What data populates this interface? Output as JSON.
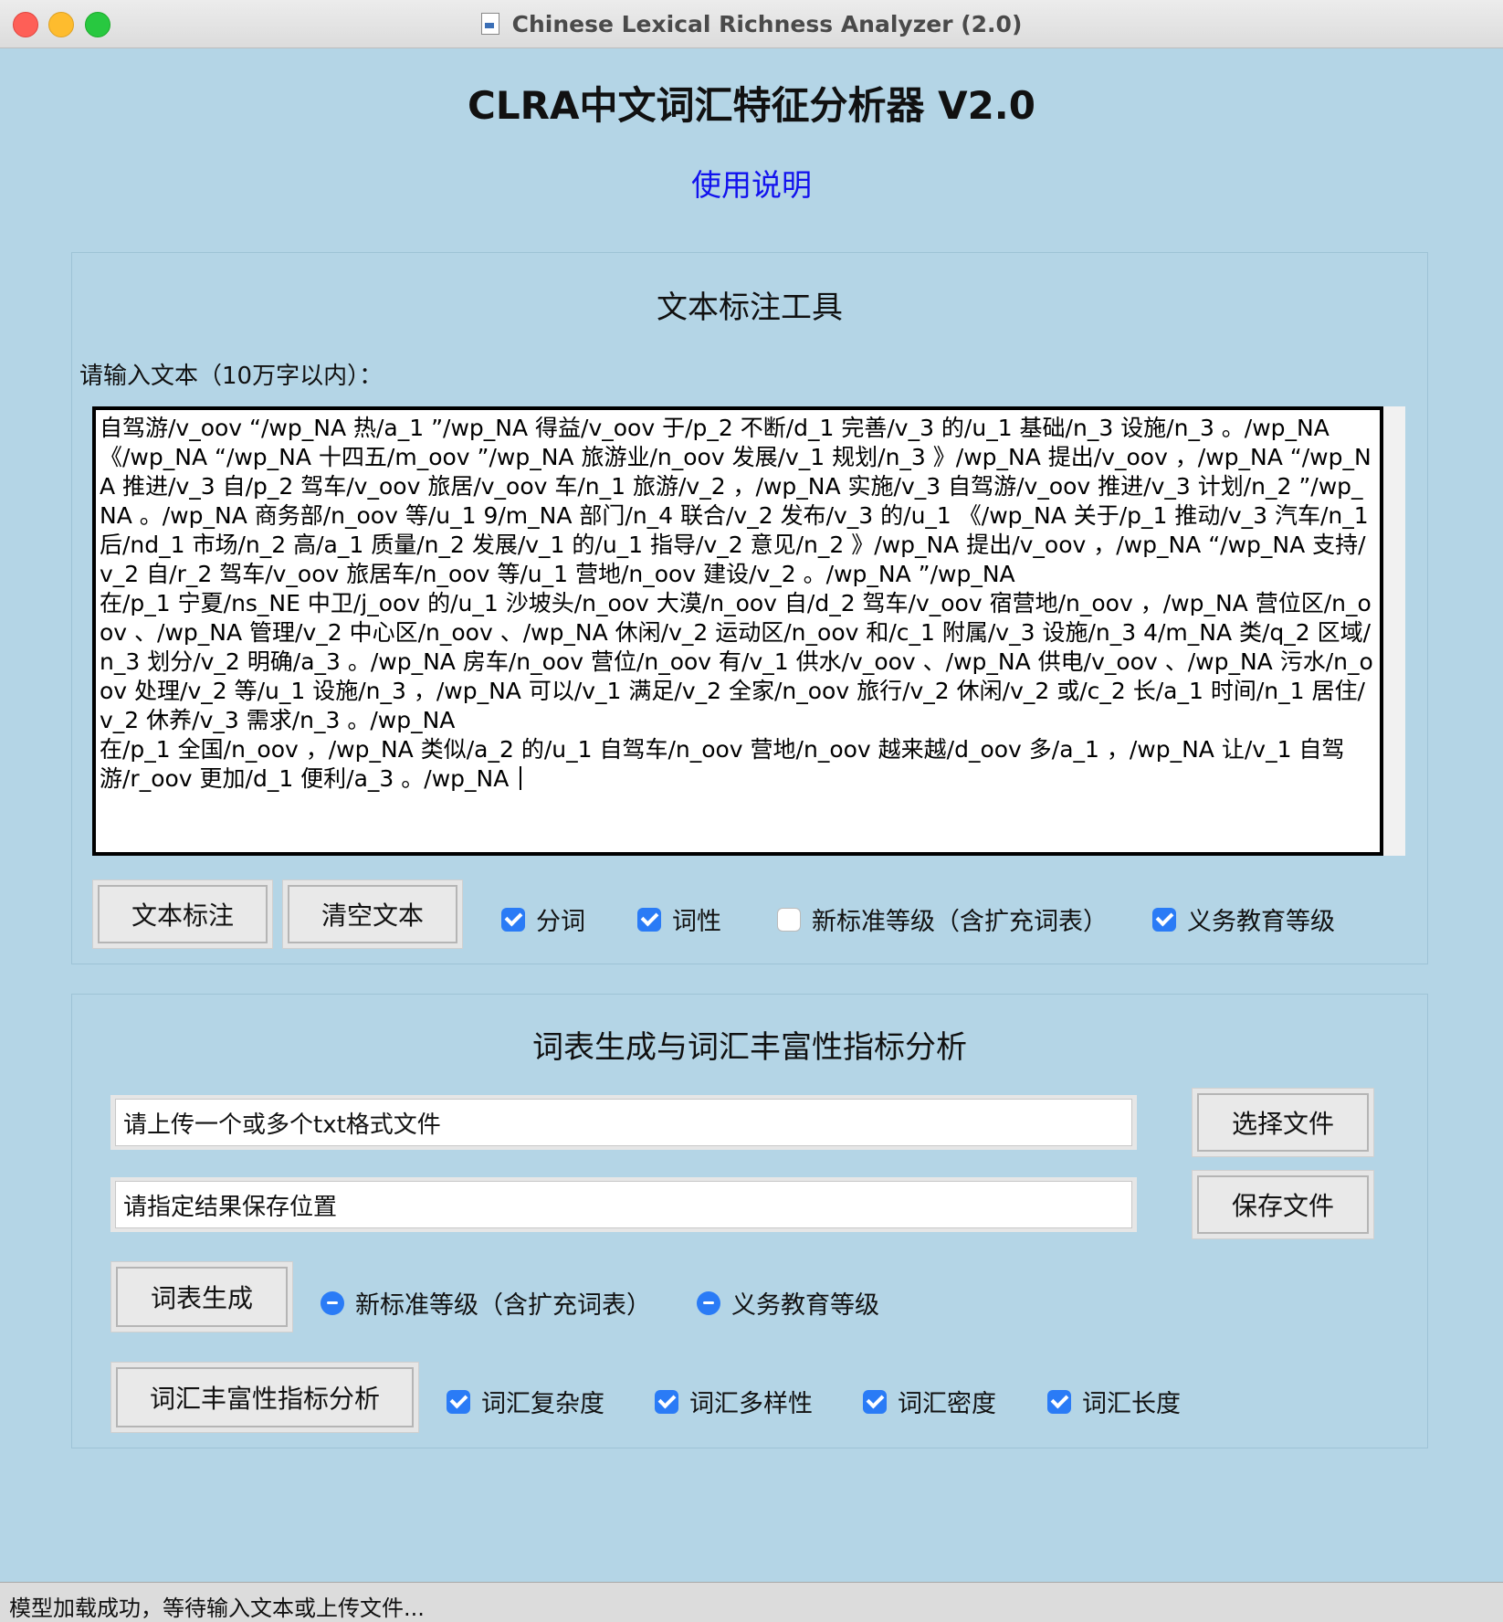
{
  "window": {
    "title": "Chinese Lexical Richness Analyzer (2.0)"
  },
  "app": {
    "heading": "CLRA中文词汇特征分析器 V2.0",
    "help_link": "使用说明"
  },
  "annotation_tool": {
    "title": "文本标注工具",
    "input_label": "请输入文本（10万字以内）：",
    "text": "自驾游/v_oov “/wp_NA 热/a_1 ”/wp_NA 得益/v_oov 于/p_2 不断/d_1 完善/v_3 的/u_1 基础/n_3 设施/n_3 。/wp_NA\n《/wp_NA “/wp_NA 十四五/m_oov ”/wp_NA 旅游业/n_oov 发展/v_1 规划/n_3 》/wp_NA 提出/v_oov ，/wp_NA “/wp_NA 推进/v_3 自/p_2 驾车/v_oov 旅居/v_oov 车/n_1 旅游/v_2 ，/wp_NA 实施/v_3 自驾游/v_oov 推进/v_3 计划/n_2 ”/wp_NA 。/wp_NA 商务部/n_oov 等/u_1 9/m_NA 部门/n_4 联合/v_2 发布/v_3 的/u_1 《/wp_NA 关于/p_1 推动/v_3 汽车/n_1 后/nd_1 市场/n_2 高/a_1 质量/n_2 发展/v_1 的/u_1 指导/v_2 意见/n_2 》/wp_NA 提出/v_oov ，/wp_NA “/wp_NA 支持/v_2 自/r_2 驾车/v_oov 旅居车/n_oov 等/u_1 营地/n_oov 建设/v_2 。/wp_NA ”/wp_NA\n在/p_1 宁夏/ns_NE 中卫/j_oov 的/u_1 沙坡头/n_oov 大漠/n_oov 自/d_2 驾车/v_oov 宿营地/n_oov ，/wp_NA 营位区/n_oov 、/wp_NA 管理/v_2 中心区/n_oov 、/wp_NA 休闲/v_2 运动区/n_oov 和/c_1 附属/v_3 设施/n_3 4/m_NA 类/q_2 区域/n_3 划分/v_2 明确/a_3 。/wp_NA 房车/n_oov 营位/n_oov 有/v_1 供水/v_oov 、/wp_NA 供电/v_oov 、/wp_NA 污水/n_oov 处理/v_2 等/u_1 设施/n_3 ，/wp_NA 可以/v_1 满足/v_2 全家/n_oov 旅行/v_2 休闲/v_2 或/c_2 长/a_1 时间/n_1 居住/v_2 休养/v_3 需求/n_3 。/wp_NA\n在/p_1 全国/n_oov ，/wp_NA 类似/a_2 的/u_1 自驾车/n_oov 营地/n_oov 越来越/d_oov 多/a_1 ，/wp_NA 让/v_1 自驾游/r_oov 更加/d_1 便利/a_3 。/wp_NA ",
    "buttons": {
      "annotate": "文本标注",
      "clear": "清空文本"
    },
    "options": [
      {
        "label": "分词",
        "checked": true
      },
      {
        "label": "词性",
        "checked": true
      },
      {
        "label": "新标准等级（含扩充词表）",
        "checked": false
      },
      {
        "label": "义务教育等级",
        "checked": true
      }
    ]
  },
  "analysis": {
    "title": "词表生成与词汇丰富性指标分析",
    "upload_field": "请上传一个或多个txt格式文件",
    "save_field": "请指定结果保存位置",
    "buttons": {
      "choose_file": "选择文件",
      "save_file": "保存文件",
      "generate": "词表生成",
      "analyze": "词汇丰富性指标分析"
    },
    "level_options": [
      "新标准等级（含扩充词表）",
      "义务教育等级"
    ],
    "metrics": [
      {
        "label": "词汇复杂度",
        "checked": true
      },
      {
        "label": "词汇多样性",
        "checked": true
      },
      {
        "label": "词汇密度",
        "checked": true
      },
      {
        "label": "词汇长度",
        "checked": true
      }
    ]
  },
  "status": "模型加载成功，等待输入文本或上传文件...",
  "colors": {
    "background": "#b4d5e6",
    "link": "#1212ee",
    "check": "#2a7bf6"
  }
}
